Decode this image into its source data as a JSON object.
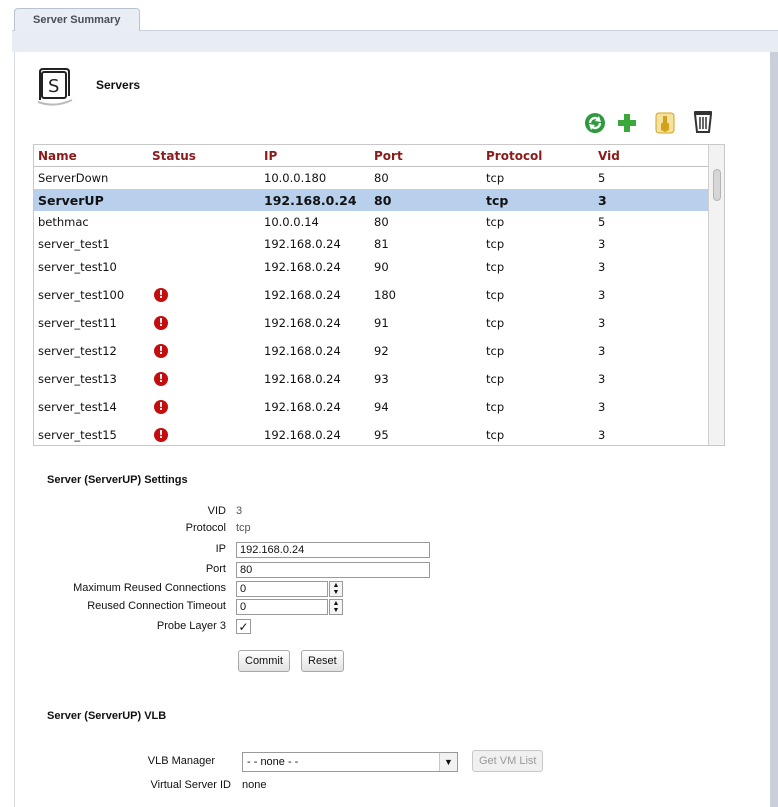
{
  "tabs": [
    {
      "label": "Server Summary"
    }
  ],
  "servers_panel": {
    "title": "Servers"
  },
  "toolbar": {
    "icons": [
      "refresh-icon",
      "add-icon",
      "wrench-icon",
      "trash-icon"
    ],
    "colors": {
      "refresh": "#2e9a3e",
      "add": "#3aa83a",
      "wrench": "#d4a21a",
      "trash": "#333333"
    }
  },
  "table": {
    "headers": [
      "Name",
      "Status",
      "IP",
      "Port",
      "Protocol",
      "Vid"
    ],
    "header_color": "#8b1a1a",
    "selected_color": "#b8d0ec",
    "rows": [
      {
        "name": "ServerDown",
        "status_error": false,
        "ip": "10.0.0.180",
        "port": "80",
        "protocol": "tcp",
        "vid": "5"
      },
      {
        "name": "ServerUP",
        "status_error": false,
        "ip": "192.168.0.24",
        "port": "80",
        "protocol": "tcp",
        "vid": "3",
        "selected": true
      },
      {
        "name": "bethmac",
        "status_error": false,
        "ip": "10.0.0.14",
        "port": "80",
        "protocol": "tcp",
        "vid": "5"
      },
      {
        "name": "server_test1",
        "status_error": false,
        "ip": "192.168.0.24",
        "port": "81",
        "protocol": "tcp",
        "vid": "3"
      },
      {
        "name": "server_test10",
        "status_error": false,
        "ip": "192.168.0.24",
        "port": "90",
        "protocol": "tcp",
        "vid": "3"
      },
      {
        "name": "server_test100",
        "status_error": true,
        "ip": "192.168.0.24",
        "port": "180",
        "protocol": "tcp",
        "vid": "3"
      },
      {
        "name": "server_test11",
        "status_error": true,
        "ip": "192.168.0.24",
        "port": "91",
        "protocol": "tcp",
        "vid": "3"
      },
      {
        "name": "server_test12",
        "status_error": true,
        "ip": "192.168.0.24",
        "port": "92",
        "protocol": "tcp",
        "vid": "3"
      },
      {
        "name": "server_test13",
        "status_error": true,
        "ip": "192.168.0.24",
        "port": "93",
        "protocol": "tcp",
        "vid": "3"
      },
      {
        "name": "server_test14",
        "status_error": true,
        "ip": "192.168.0.24",
        "port": "94",
        "protocol": "tcp",
        "vid": "3"
      },
      {
        "name": "server_test15",
        "status_error": true,
        "ip": "192.168.0.24",
        "port": "95",
        "protocol": "tcp",
        "vid": "3"
      }
    ]
  },
  "settings": {
    "title": "Server (ServerUP) Settings",
    "vid_label": "VID",
    "vid_value": "3",
    "protocol_label": "Protocol",
    "protocol_value": "tcp",
    "ip_label": "IP",
    "ip_value": "192.168.0.24",
    "port_label": "Port",
    "port_value": "80",
    "max_reused_label": "Maximum Reused Connections",
    "max_reused_value": "0",
    "reused_timeout_label": "Reused Connection Timeout",
    "reused_timeout_value": "0",
    "probe_label": "Probe Layer 3",
    "probe_checked": "✓",
    "commit_label": "Commit",
    "reset_label": "Reset"
  },
  "vlb": {
    "title": "Server (ServerUP) VLB",
    "manager_label": "VLB Manager",
    "manager_value": "- - none - -",
    "get_vm_label": "Get VM List",
    "virtual_server_label": "Virtual Server ID",
    "virtual_server_value": "none"
  }
}
